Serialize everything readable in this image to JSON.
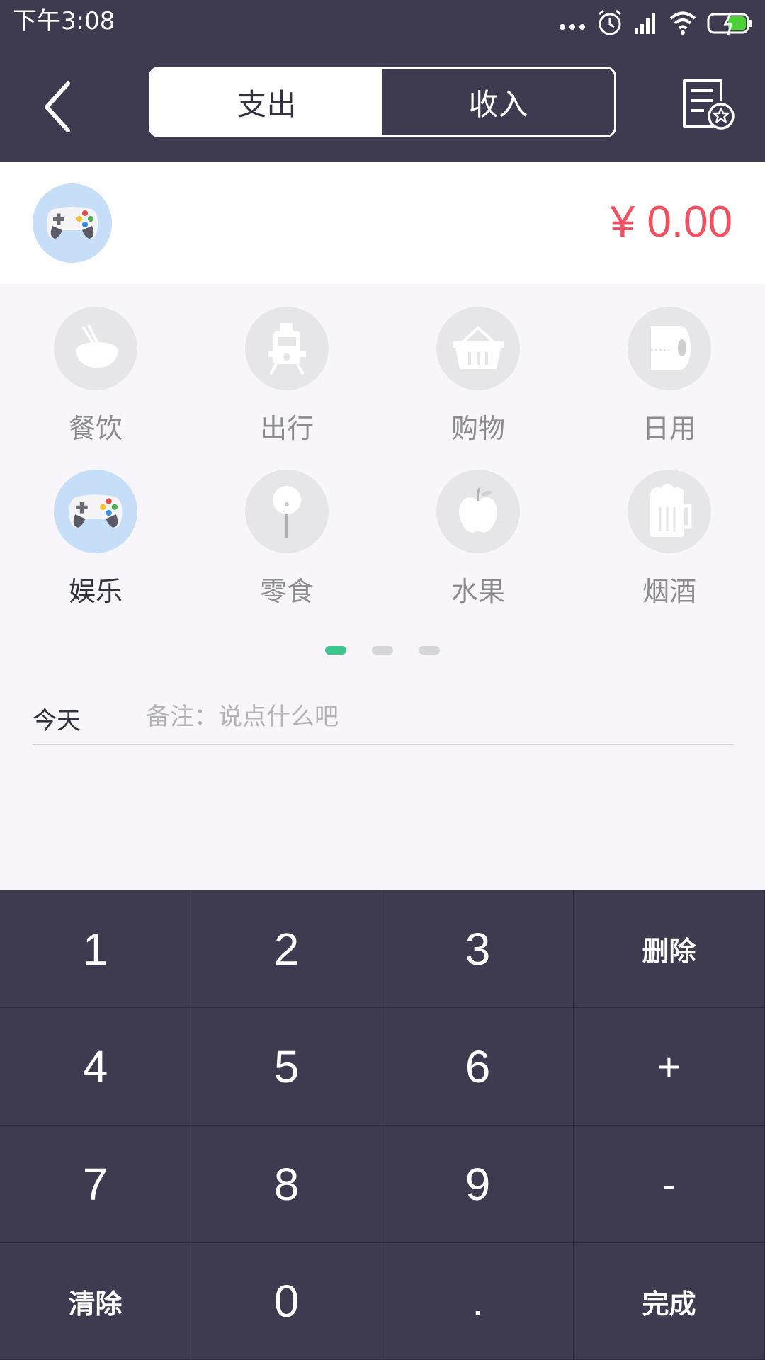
{
  "status_bar": {
    "time": "下午3:08",
    "icons": [
      "more-dots-icon",
      "alarm-icon",
      "signal-icon",
      "wifi-icon",
      "battery-charging-icon"
    ]
  },
  "header": {
    "tabs": [
      {
        "label": "支出",
        "active": true
      },
      {
        "label": "收入",
        "active": false
      }
    ],
    "back_icon": "chevron-left-icon",
    "record_icon": "document-star-icon"
  },
  "amount_row": {
    "selected_category_icon": "gamepad-icon",
    "amount": "¥ 0.00"
  },
  "categories": [
    {
      "label": "餐饮",
      "icon": "rice-bowl-icon",
      "selected": false
    },
    {
      "label": "出行",
      "icon": "train-icon",
      "selected": false
    },
    {
      "label": "购物",
      "icon": "basket-icon",
      "selected": false
    },
    {
      "label": "日用",
      "icon": "tissue-roll-icon",
      "selected": false
    },
    {
      "label": "娱乐",
      "icon": "gamepad-icon",
      "selected": true
    },
    {
      "label": "零食",
      "icon": "lollipop-icon",
      "selected": false
    },
    {
      "label": "水果",
      "icon": "apple-icon",
      "selected": false
    },
    {
      "label": "烟酒",
      "icon": "beer-mug-icon",
      "selected": false
    }
  ],
  "pager": {
    "pages": 3,
    "current": 1
  },
  "remark": {
    "date_label": "今天",
    "placeholder": "备注：说点什么吧",
    "value": ""
  },
  "keypad": {
    "keys": [
      [
        "1",
        "2",
        "3",
        "删除"
      ],
      [
        "4",
        "5",
        "6",
        "+"
      ],
      [
        "7",
        "8",
        "9",
        "-"
      ],
      [
        "清除",
        "0",
        ".",
        "完成"
      ]
    ]
  },
  "colors": {
    "bar_bg": "#3e3b50",
    "amount": "#f0505f",
    "active_dot": "#3ec48d",
    "selected_circle": "#c6def7"
  }
}
